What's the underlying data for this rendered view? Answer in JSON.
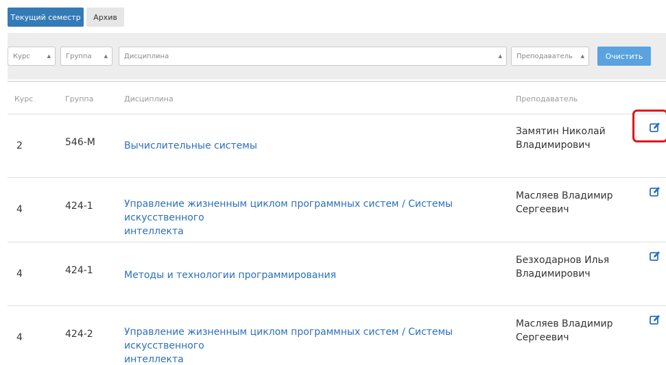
{
  "tabs": {
    "current_label": "Текущий семестр",
    "archive_label": "Архив"
  },
  "filters": {
    "course": "Курс",
    "group": "Группа",
    "discipline": "Дисциплина",
    "teacher": "Преподаватель",
    "clear_label": "Очистить",
    "arrow_icon": "triangle-up"
  },
  "table": {
    "headers": {
      "course": "Курс",
      "group": "Группа",
      "discipline": "Дисциплина",
      "teacher": "Преподаватель"
    },
    "rows": [
      {
        "course": "2",
        "group": "546-М",
        "discipline_lines": [
          "Вычислительные системы"
        ],
        "teacher_lines": [
          "Замятин Николай",
          "Владимирович"
        ]
      },
      {
        "course": "4",
        "group": "424-1",
        "discipline_lines": [
          "Управление жизненным циклом программных систем / Системы искусственного",
          "интеллекта"
        ],
        "teacher_lines": [
          "Масляев Владимир",
          "Сергеевич"
        ]
      },
      {
        "course": "4",
        "group": "424-1",
        "discipline_lines": [
          "Методы и технологии программирования"
        ],
        "teacher_lines": [
          "Безходарнов Илья",
          "Владимирович"
        ]
      },
      {
        "course": "4",
        "group": "424-2",
        "discipline_lines": [
          "Управление жизненным циклом программных систем / Системы искусственного",
          "интеллекта"
        ],
        "teacher_lines": [
          "Масляев Владимир",
          "Сергеевич"
        ]
      }
    ]
  },
  "colors": {
    "accent": "#337ab7",
    "link": "#2a6fbf",
    "highlight": "#e0101a",
    "clear_button": "#5aa3e0"
  },
  "icons": {
    "edit": "edit-icon"
  }
}
